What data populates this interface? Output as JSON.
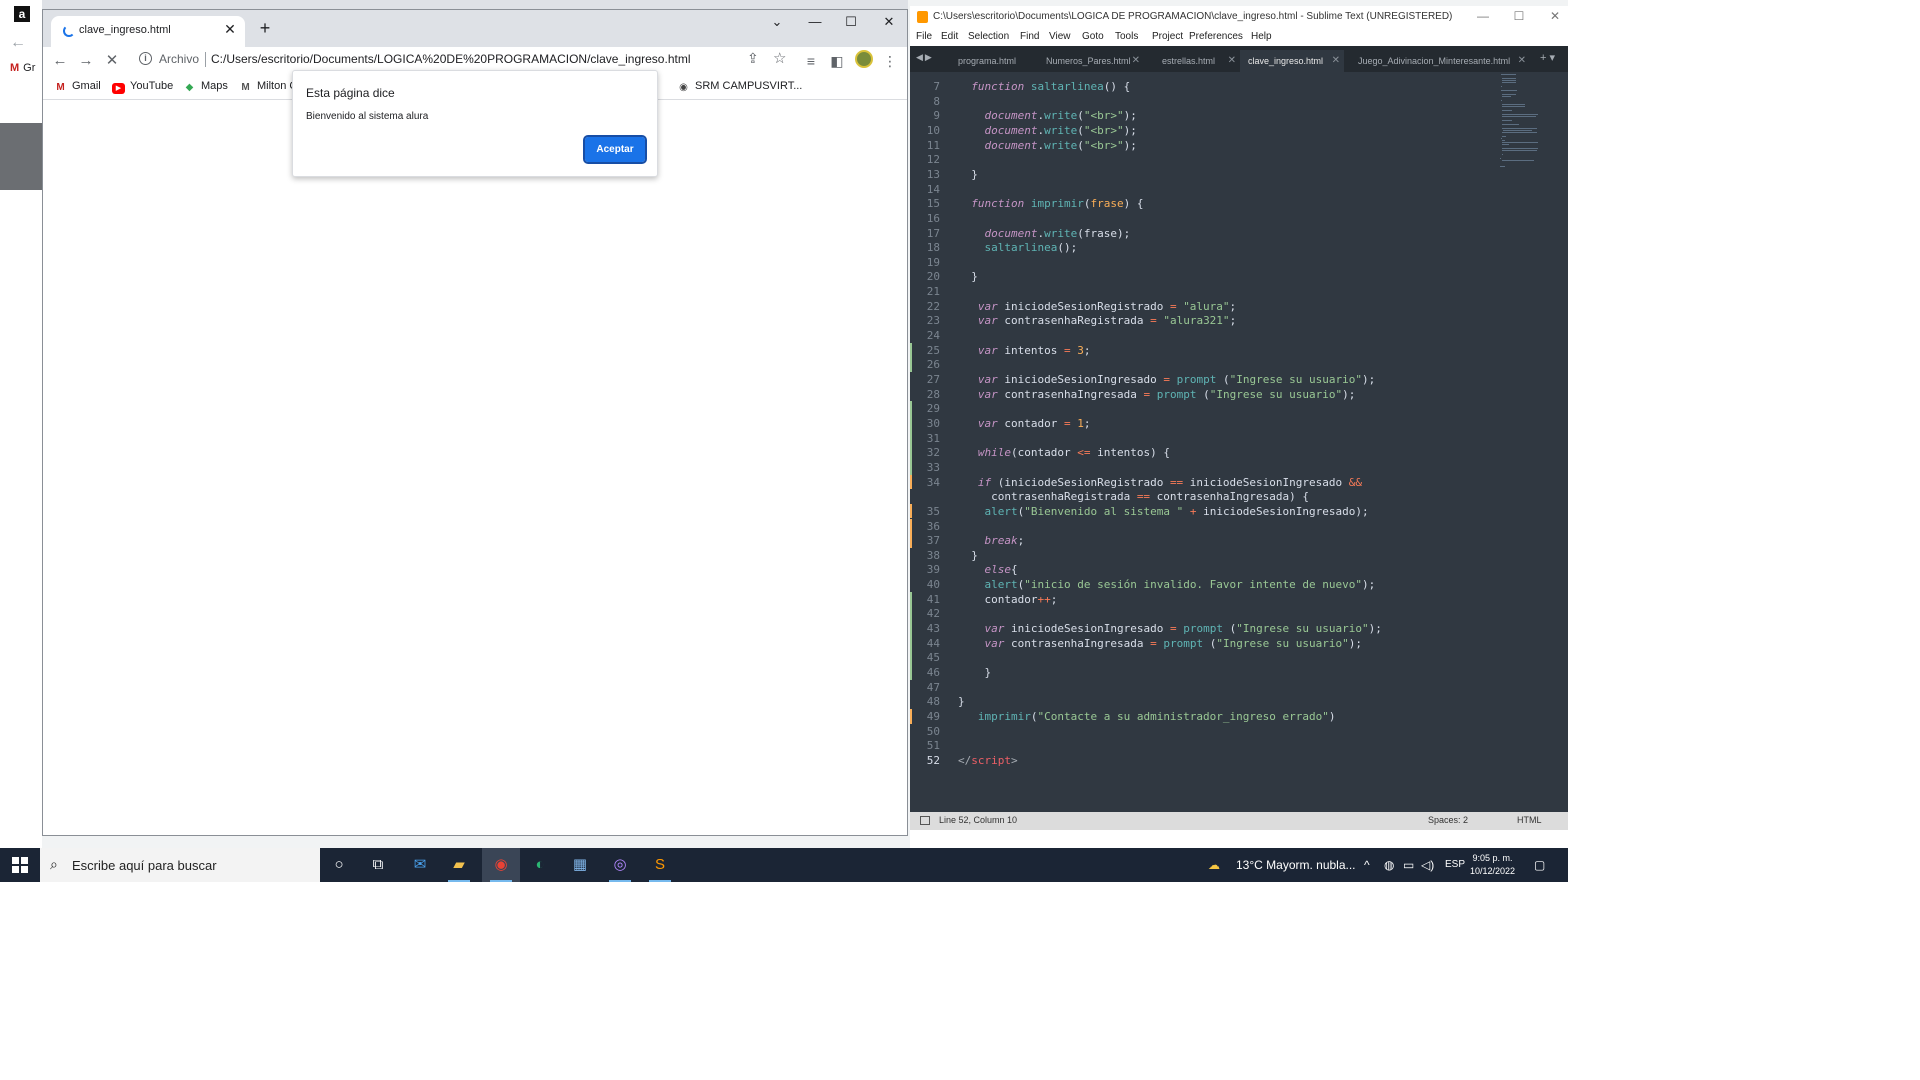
{
  "background": {
    "partial_bookmark": "Gr"
  },
  "browser": {
    "tab_title": "clave_ingreso.html",
    "new_tab_symbol": "+",
    "scheme_label": "Archivo",
    "url": "C:/Users/escritorio/Documents/LOGICA%20DE%20PROGRAMACION/clave_ingreso.html",
    "bookmarks": [
      "Gmail",
      "YouTube",
      "Maps",
      "Milton C",
      "SRM CAMPUSVIRT..."
    ]
  },
  "dialog": {
    "title": "Esta página dice",
    "message": "Bienvenido al sistema alura",
    "ok_label": "Aceptar"
  },
  "editor": {
    "window_title": "C:\\Users\\escritorio\\Documents\\LOGICA DE PROGRAMACION\\clave_ingreso.html - Sublime Text (UNREGISTERED)",
    "menu": [
      "File",
      "Edit",
      "Selection",
      "Find",
      "View",
      "Goto",
      "Tools",
      "Project",
      "Preferences",
      "Help"
    ],
    "tabs": [
      "programa.html",
      "Numeros_Pares.html",
      "estrellas.html",
      "clave_ingreso.html",
      "Juego_Adivinacion_Minteresante.html"
    ],
    "active_tab": 3,
    "status_position": "Line 52, Column 10",
    "status_spaces": "Spaces: 2",
    "status_syntax": "HTML",
    "syntax_colors": {
      "keyword": "#c594c5",
      "function": "#5fb4b4",
      "string": "#99c794",
      "number": "#f9ae58",
      "operator": "#f97b58",
      "text": "#d8dee9",
      "tag": "#ec5f66"
    },
    "lines": [
      {
        "n": "7",
        "segs": [
          {
            "t": "  "
          },
          {
            "t": "function",
            "c": "kw"
          },
          {
            "t": " "
          },
          {
            "t": "saltarlinea",
            "c": "fn"
          },
          {
            "t": "() {"
          }
        ]
      },
      {
        "n": "8",
        "segs": [
          {
            "t": ""
          }
        ]
      },
      {
        "n": "9",
        "segs": [
          {
            "t": "    "
          },
          {
            "t": "document",
            "c": "kw"
          },
          {
            "t": "."
          },
          {
            "t": "write",
            "c": "fn"
          },
          {
            "t": "("
          },
          {
            "t": "\"<br>\"",
            "c": "str"
          },
          {
            "t": ");"
          }
        ]
      },
      {
        "n": "10",
        "segs": [
          {
            "t": "    "
          },
          {
            "t": "document",
            "c": "kw"
          },
          {
            "t": "."
          },
          {
            "t": "write",
            "c": "fn"
          },
          {
            "t": "("
          },
          {
            "t": "\"<br>\"",
            "c": "str"
          },
          {
            "t": ");"
          }
        ]
      },
      {
        "n": "11",
        "segs": [
          {
            "t": "    "
          },
          {
            "t": "document",
            "c": "kw"
          },
          {
            "t": "."
          },
          {
            "t": "write",
            "c": "fn"
          },
          {
            "t": "("
          },
          {
            "t": "\"<br>\"",
            "c": "str"
          },
          {
            "t": ");"
          }
        ]
      },
      {
        "n": "12",
        "segs": [
          {
            "t": ""
          }
        ]
      },
      {
        "n": "13",
        "segs": [
          {
            "t": "  }"
          }
        ]
      },
      {
        "n": "14",
        "segs": [
          {
            "t": ""
          }
        ]
      },
      {
        "n": "15",
        "segs": [
          {
            "t": "  "
          },
          {
            "t": "function",
            "c": "kw"
          },
          {
            "t": " "
          },
          {
            "t": "imprimir",
            "c": "fn"
          },
          {
            "t": "("
          },
          {
            "t": "frase",
            "c": "num"
          },
          {
            "t": ") {"
          }
        ]
      },
      {
        "n": "16",
        "segs": [
          {
            "t": ""
          }
        ]
      },
      {
        "n": "17",
        "segs": [
          {
            "t": "    "
          },
          {
            "t": "document",
            "c": "kw"
          },
          {
            "t": "."
          },
          {
            "t": "write",
            "c": "fn"
          },
          {
            "t": "(frase);"
          }
        ]
      },
      {
        "n": "18",
        "segs": [
          {
            "t": "    "
          },
          {
            "t": "saltarlinea",
            "c": "fn"
          },
          {
            "t": "();"
          }
        ]
      },
      {
        "n": "19",
        "segs": [
          {
            "t": ""
          }
        ]
      },
      {
        "n": "20",
        "segs": [
          {
            "t": "  }"
          }
        ]
      },
      {
        "n": "21",
        "segs": [
          {
            "t": ""
          }
        ]
      },
      {
        "n": "22",
        "segs": [
          {
            "t": "   "
          },
          {
            "t": "var",
            "c": "kw"
          },
          {
            "t": " iniciodeSesionRegistrado "
          },
          {
            "t": "=",
            "c": "op"
          },
          {
            "t": " "
          },
          {
            "t": "\"alura\"",
            "c": "str"
          },
          {
            "t": ";"
          }
        ]
      },
      {
        "n": "23",
        "segs": [
          {
            "t": "   "
          },
          {
            "t": "var",
            "c": "kw"
          },
          {
            "t": " contrasenhaRegistrada "
          },
          {
            "t": "=",
            "c": "op"
          },
          {
            "t": " "
          },
          {
            "t": "\"alura321\"",
            "c": "str"
          },
          {
            "t": ";"
          }
        ]
      },
      {
        "n": "24",
        "segs": [
          {
            "t": ""
          }
        ]
      },
      {
        "n": "25",
        "segs": [
          {
            "t": "   "
          },
          {
            "t": "var",
            "c": "kw"
          },
          {
            "t": " intentos "
          },
          {
            "t": "=",
            "c": "op"
          },
          {
            "t": " "
          },
          {
            "t": "3",
            "c": "num"
          },
          {
            "t": ";"
          }
        ]
      },
      {
        "n": "26",
        "segs": [
          {
            "t": ""
          }
        ]
      },
      {
        "n": "27",
        "segs": [
          {
            "t": "   "
          },
          {
            "t": "var",
            "c": "kw"
          },
          {
            "t": " iniciodeSesionIngresado "
          },
          {
            "t": "=",
            "c": "op"
          },
          {
            "t": " "
          },
          {
            "t": "prompt",
            "c": "fn"
          },
          {
            "t": " ("
          },
          {
            "t": "\"Ingrese su usuario\"",
            "c": "str"
          },
          {
            "t": ");"
          }
        ]
      },
      {
        "n": "28",
        "segs": [
          {
            "t": "   "
          },
          {
            "t": "var",
            "c": "kw"
          },
          {
            "t": " contrasenhaIngresada "
          },
          {
            "t": "=",
            "c": "op"
          },
          {
            "t": " "
          },
          {
            "t": "prompt",
            "c": "fn"
          },
          {
            "t": " ("
          },
          {
            "t": "\"Ingrese su usuario\"",
            "c": "str"
          },
          {
            "t": ");"
          }
        ]
      },
      {
        "n": "29",
        "segs": [
          {
            "t": ""
          }
        ]
      },
      {
        "n": "30",
        "segs": [
          {
            "t": "   "
          },
          {
            "t": "var",
            "c": "kw"
          },
          {
            "t": " contador "
          },
          {
            "t": "=",
            "c": "op"
          },
          {
            "t": " "
          },
          {
            "t": "1",
            "c": "num"
          },
          {
            "t": ";"
          }
        ]
      },
      {
        "n": "31",
        "segs": [
          {
            "t": ""
          }
        ]
      },
      {
        "n": "32",
        "segs": [
          {
            "t": "   "
          },
          {
            "t": "while",
            "c": "kw"
          },
          {
            "t": "(contador "
          },
          {
            "t": "<=",
            "c": "op"
          },
          {
            "t": " intentos) {"
          }
        ]
      },
      {
        "n": "33",
        "segs": [
          {
            "t": ""
          }
        ]
      },
      {
        "n": "34",
        "segs": [
          {
            "t": "   "
          },
          {
            "t": "if",
            "c": "kw"
          },
          {
            "t": " (iniciodeSesionRegistrado "
          },
          {
            "t": "==",
            "c": "op"
          },
          {
            "t": " iniciodeSesionIngresado "
          },
          {
            "t": "&&",
            "c": "op"
          }
        ]
      },
      {
        "n": "",
        "segs": [
          {
            "t": "     contrasenhaRegistrada "
          },
          {
            "t": "==",
            "c": "op"
          },
          {
            "t": " contrasenhaIngresada) {"
          }
        ]
      },
      {
        "n": "35",
        "segs": [
          {
            "t": "    "
          },
          {
            "t": "alert",
            "c": "fn"
          },
          {
            "t": "("
          },
          {
            "t": "\"Bienvenido al sistema \"",
            "c": "str"
          },
          {
            "t": " "
          },
          {
            "t": "+",
            "c": "op"
          },
          {
            "t": " iniciodeSesionIngresado);"
          }
        ]
      },
      {
        "n": "36",
        "segs": [
          {
            "t": ""
          }
        ]
      },
      {
        "n": "37",
        "segs": [
          {
            "t": "    "
          },
          {
            "t": "break",
            "c": "kw"
          },
          {
            "t": ";"
          }
        ]
      },
      {
        "n": "38",
        "segs": [
          {
            "t": "  }"
          }
        ]
      },
      {
        "n": "39",
        "segs": [
          {
            "t": "    "
          },
          {
            "t": "else",
            "c": "kw"
          },
          {
            "t": "{"
          }
        ]
      },
      {
        "n": "40",
        "segs": [
          {
            "t": "    "
          },
          {
            "t": "alert",
            "c": "fn"
          },
          {
            "t": "("
          },
          {
            "t": "\"inicio de sesión invalido. Favor intente de nuevo\"",
            "c": "str"
          },
          {
            "t": ");"
          }
        ]
      },
      {
        "n": "41",
        "segs": [
          {
            "t": "    contador"
          },
          {
            "t": "++",
            "c": "op"
          },
          {
            "t": ";"
          }
        ]
      },
      {
        "n": "42",
        "segs": [
          {
            "t": ""
          }
        ]
      },
      {
        "n": "43",
        "segs": [
          {
            "t": "    "
          },
          {
            "t": "var",
            "c": "kw"
          },
          {
            "t": " iniciodeSesionIngresado "
          },
          {
            "t": "=",
            "c": "op"
          },
          {
            "t": " "
          },
          {
            "t": "prompt",
            "c": "fn"
          },
          {
            "t": " ("
          },
          {
            "t": "\"Ingrese su usuario\"",
            "c": "str"
          },
          {
            "t": ");"
          }
        ]
      },
      {
        "n": "44",
        "segs": [
          {
            "t": "    "
          },
          {
            "t": "var",
            "c": "kw"
          },
          {
            "t": " contrasenhaIngresada "
          },
          {
            "t": "=",
            "c": "op"
          },
          {
            "t": " "
          },
          {
            "t": "prompt",
            "c": "fn"
          },
          {
            "t": " ("
          },
          {
            "t": "\"Ingrese su usuario\"",
            "c": "str"
          },
          {
            "t": ");"
          }
        ]
      },
      {
        "n": "45",
        "segs": [
          {
            "t": ""
          }
        ]
      },
      {
        "n": "46",
        "segs": [
          {
            "t": "    }"
          }
        ]
      },
      {
        "n": "47",
        "segs": [
          {
            "t": ""
          }
        ]
      },
      {
        "n": "48",
        "segs": [
          {
            "t": "}"
          }
        ]
      },
      {
        "n": "49",
        "segs": [
          {
            "t": "   "
          },
          {
            "t": "imprimir",
            "c": "fn"
          },
          {
            "t": "("
          },
          {
            "t": "\"Contacte a su administrador_ingreso errado\"",
            "c": "str"
          },
          {
            "t": ")"
          }
        ]
      },
      {
        "n": "50",
        "segs": [
          {
            "t": ""
          }
        ]
      },
      {
        "n": "51",
        "segs": [
          {
            "t": ""
          }
        ]
      },
      {
        "n": "52",
        "segs": [
          {
            "t": "</",
            "c": "punct"
          },
          {
            "t": "script",
            "c": "tag"
          },
          {
            "t": ">",
            "c": "punct"
          }
        ]
      }
    ]
  },
  "taskbar": {
    "search_placeholder": "Escribe aquí para buscar",
    "weather": "13°C  Mayorm. nubla...",
    "language": "ESP",
    "time": "9:05 p. m.",
    "date": "10/12/2022"
  }
}
